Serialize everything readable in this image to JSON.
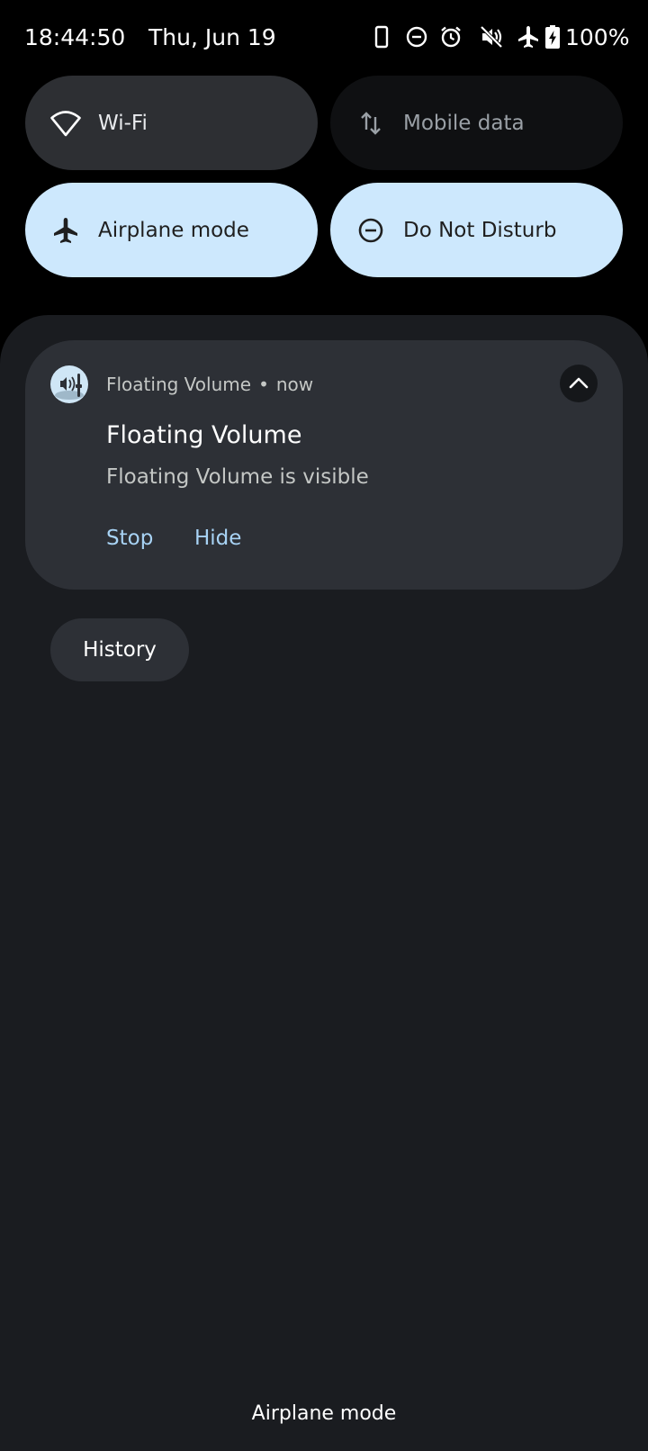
{
  "status_bar": {
    "time": "18:44:50",
    "date": "Thu, Jun 19",
    "battery_percent": "100%",
    "icons": [
      "phone-icon",
      "do-not-disturb-icon",
      "alarm-icon",
      "mute-icon",
      "airplane-icon",
      "battery-charging-icon"
    ]
  },
  "quick_settings": {
    "tiles": [
      {
        "label": "Wi-Fi",
        "icon": "wifi-icon",
        "state": "available"
      },
      {
        "label": "Mobile data",
        "icon": "mobile-data-icon",
        "state": "off"
      },
      {
        "label": "Airplane mode",
        "icon": "airplane-icon",
        "state": "on"
      },
      {
        "label": "Do Not Disturb",
        "icon": "do-not-disturb-icon",
        "state": "on"
      }
    ]
  },
  "notification": {
    "app_name": "Floating Volume",
    "separator": "•",
    "time": "now",
    "title": "Floating Volume",
    "text": "Floating Volume is visible",
    "actions": [
      "Stop",
      "Hide"
    ]
  },
  "history_label": "History",
  "footer_status": "Airplane mode",
  "colors": {
    "tile_on": "#cde8fd",
    "tile_available": "#2d2f33",
    "tile_off": "#0f1012",
    "shade": "#1a1c20",
    "card": "#2d3036",
    "action_text": "#a8d3f5"
  }
}
